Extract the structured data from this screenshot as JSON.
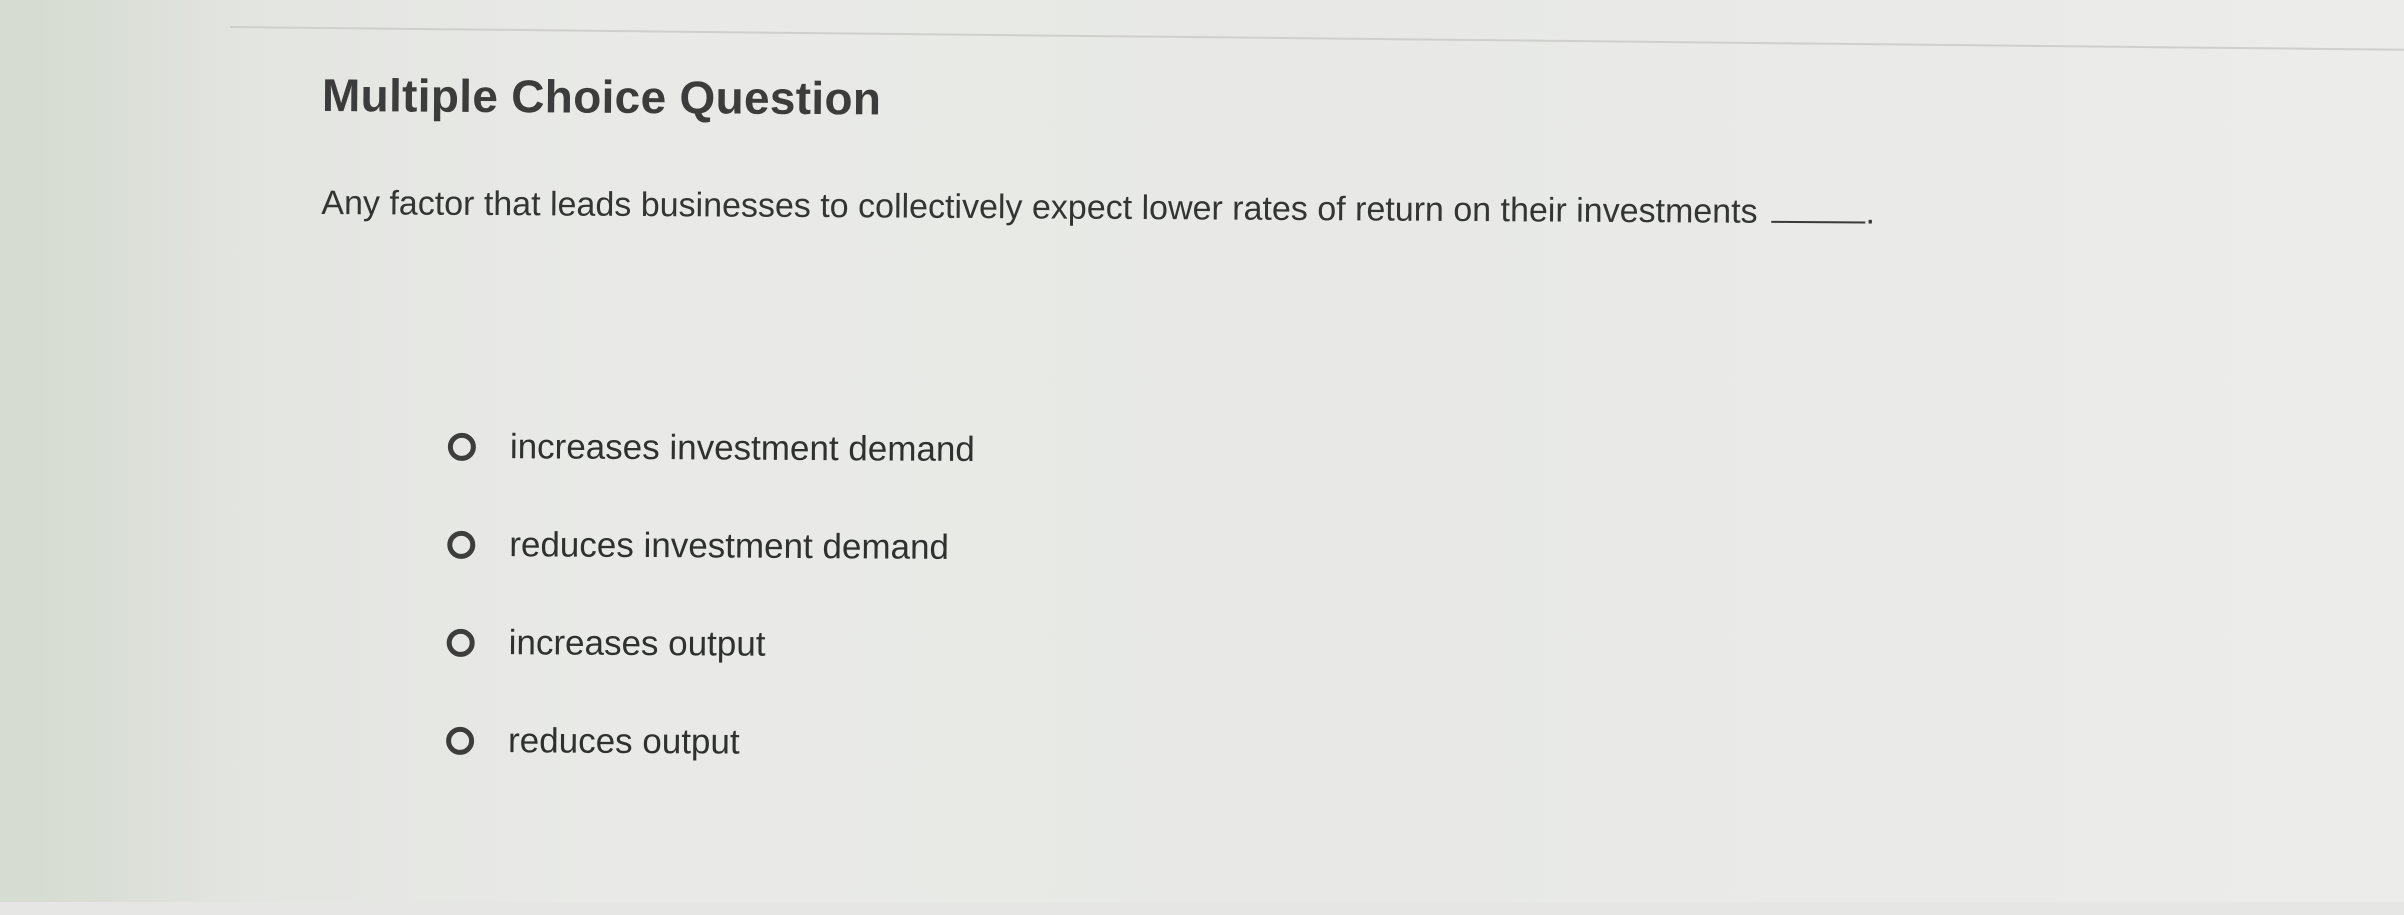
{
  "question": {
    "heading": "Multiple Choice Question",
    "prompt": "Any factor that leads businesses to collectively expect lower rates of return on their investments",
    "blank_suffix": ".",
    "options": [
      {
        "label": "increases investment demand",
        "selected": false
      },
      {
        "label": "reduces investment demand",
        "selected": false
      },
      {
        "label": "increases output",
        "selected": false
      },
      {
        "label": "reduces output",
        "selected": false
      }
    ]
  },
  "colors": {
    "text_primary": "#333533",
    "radio_border": "#3d3e3c",
    "background": "#e6e7e4"
  }
}
